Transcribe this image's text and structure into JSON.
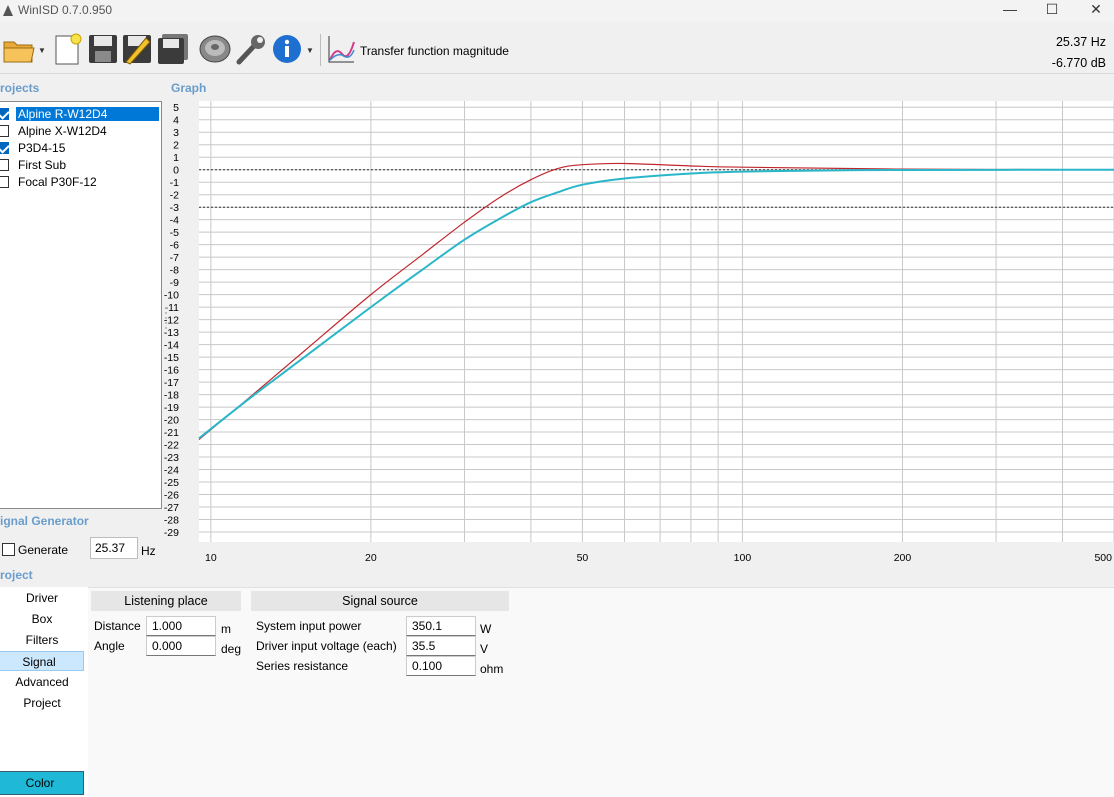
{
  "window": {
    "title": "WinISD 0.7.0.950",
    "minimize": "—",
    "maximize": "☐",
    "close": "✕"
  },
  "toolbar": {
    "icons": [
      "open-folder-icon",
      "new-project-icon",
      "save-icon",
      "edit-icon",
      "save-all-icon",
      "driver-icon",
      "wrench-icon",
      "info-icon",
      "graph-type-icon"
    ],
    "graph_type_label": "Transfer function magnitude",
    "readout_freq": "25.37 Hz",
    "readout_value": "-6.770 dB"
  },
  "projects": {
    "section_label": "rojects",
    "items": [
      {
        "name": "Alpine R-W12D4",
        "checked": true,
        "selected": true
      },
      {
        "name": "Alpine X-W12D4",
        "checked": false,
        "selected": false
      },
      {
        "name": "P3D4-15",
        "checked": true,
        "selected": false
      },
      {
        "name": "First Sub",
        "checked": false,
        "selected": false
      },
      {
        "name": "Focal P30F-12",
        "checked": false,
        "selected": false
      }
    ]
  },
  "graph": {
    "section_label": "Graph"
  },
  "signal_generator": {
    "section_label": "ignal Generator",
    "generate_label": "Generate",
    "frequency": "25.37",
    "unit": "Hz"
  },
  "project_panel": {
    "section_label": "roject",
    "tabs": [
      "Driver",
      "Box",
      "Filters",
      "Signal",
      "Advanced",
      "Project"
    ],
    "active_tab": "Signal",
    "color_button": "Color"
  },
  "listening_place": {
    "header": "Listening place",
    "distance_label": "Distance",
    "distance_value": "1.000",
    "distance_unit": "m",
    "angle_label": "Angle",
    "angle_value": "0.000",
    "angle_unit": "deg"
  },
  "signal_source": {
    "header": "Signal source",
    "power_label": "System input power",
    "power_value": "350.1",
    "power_unit": "W",
    "voltage_label": "Driver input voltage (each)",
    "voltage_value": "35.5",
    "voltage_unit": "V",
    "resistance_label": "Series resistance",
    "resistance_value": "0.100",
    "resistance_unit": "ohm"
  },
  "colors": {
    "accent": "#1fb8d6",
    "selection": "#0078d7",
    "series_red": "#c0262d",
    "series_cyan": "#2ab6c9",
    "section_label": "#6a9dcc"
  },
  "chart_data": {
    "type": "line",
    "title": "",
    "xlabel": "",
    "ylabel": "",
    "x_scale": "log",
    "xlim": [
      9.5,
      500
    ],
    "ylim": [
      -29.8,
      5.5
    ],
    "x_tick_labels": [
      10,
      20,
      50,
      100,
      200,
      500
    ],
    "y_tick_labels": [
      5,
      4,
      3,
      2,
      1,
      0,
      -1,
      -2,
      -3,
      -4,
      -5,
      -6,
      -7,
      -8,
      -9,
      -10,
      -11,
      -12,
      -13,
      -14,
      -15,
      -16,
      -17,
      -18,
      -19,
      -20,
      -21,
      -22,
      -23,
      -24,
      -25,
      -26,
      -27,
      -28,
      -29
    ],
    "reference_lines": [
      0,
      -3
    ],
    "grid": true,
    "series": [
      {
        "color": "#c0262d",
        "x": [
          9.5,
          12,
          15,
          20,
          25,
          30,
          35,
          40,
          45,
          50,
          60,
          80,
          100,
          200,
          500
        ],
        "y": [
          -21.6,
          -18.0,
          -14.5,
          -10.0,
          -6.8,
          -4.2,
          -2.2,
          -0.8,
          0.1,
          0.4,
          0.5,
          0.3,
          0.2,
          0.05,
          0.0
        ]
      },
      {
        "color": "#2ab6c9",
        "x": [
          9.5,
          12,
          15,
          20,
          25,
          30,
          35,
          40,
          45,
          50,
          60,
          80,
          100,
          150,
          200,
          500
        ],
        "y": [
          -21.5,
          -18.1,
          -15.0,
          -11.0,
          -8.0,
          -5.6,
          -3.9,
          -2.6,
          -1.8,
          -1.2,
          -0.7,
          -0.3,
          -0.15,
          -0.05,
          -0.02,
          0.0
        ]
      }
    ]
  }
}
